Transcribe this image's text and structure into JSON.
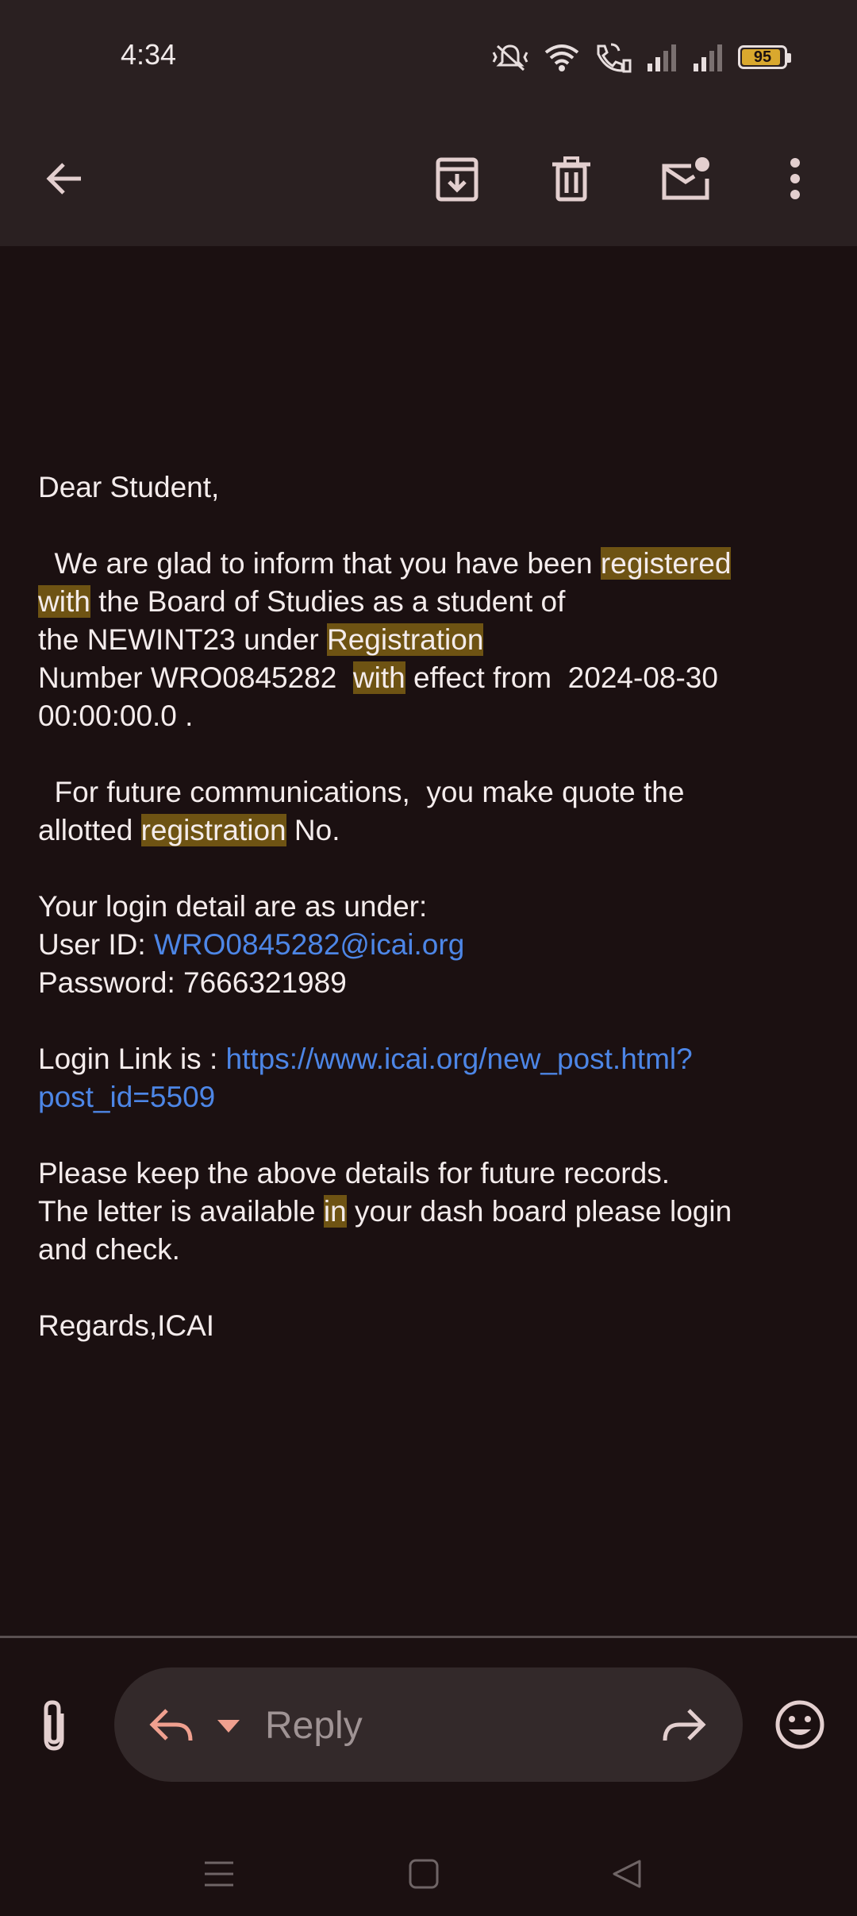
{
  "status_bar": {
    "time": "4:34",
    "battery_level": "95",
    "icons": [
      "mute-icon",
      "wifi-icon",
      "wifi-calling-icon",
      "signal-1-icon",
      "signal-2-icon",
      "battery-icon"
    ]
  },
  "toolbar": {
    "icons": [
      "back-arrow-icon",
      "archive-icon",
      "delete-icon",
      "mark-unread-icon",
      "more-options-icon"
    ]
  },
  "email": {
    "greeting": "Dear Student,",
    "p1_a": "  We are glad to inform that you have been ",
    "p1_hl1": "registered",
    "p1_hl2": "with",
    "p1_b": " the Board of Studies as a student of",
    "p1_c": "the NEWINT23 under ",
    "p1_hl3": "Registration",
    "p1_d": "Number WRO0845282  ",
    "p1_hl4": "with",
    "p1_e": " effect from  2024-08-30",
    "p1_f": "00:00:00.0 .",
    "p2_a": "  For future communications,  you make quote the",
    "p2_b": "allotted ",
    "p2_hl": "registration",
    "p2_c": " No.",
    "login_intro": "Your login detail are as under:",
    "user_id_label": "User ID: ",
    "user_id_value": "WRO0845282@icai.org",
    "password_line": "Password:  7666321989",
    "login_link_label": "Login Link is : ",
    "login_link_part1": "https://www.icai.org/new_post.html?",
    "login_link_part2": "post_id=5509",
    "keep_line": "Please keep the above details for future records.",
    "letter_a": "The letter is available ",
    "letter_hl": "in",
    "letter_b": " your dash board please login",
    "letter_c": "and check.",
    "regards": "Regards,ICAI"
  },
  "reply_bar": {
    "reply_placeholder": "Reply",
    "icons": [
      "attachment-icon",
      "reply-icon",
      "dropdown-arrow-icon",
      "forward-icon",
      "emoji-icon"
    ]
  },
  "colors": {
    "background": "#1b1011",
    "bar_background": "#2a2021",
    "highlight": "#6e5313",
    "link": "#4d86e6",
    "reply_icon": "#f0a08f"
  }
}
